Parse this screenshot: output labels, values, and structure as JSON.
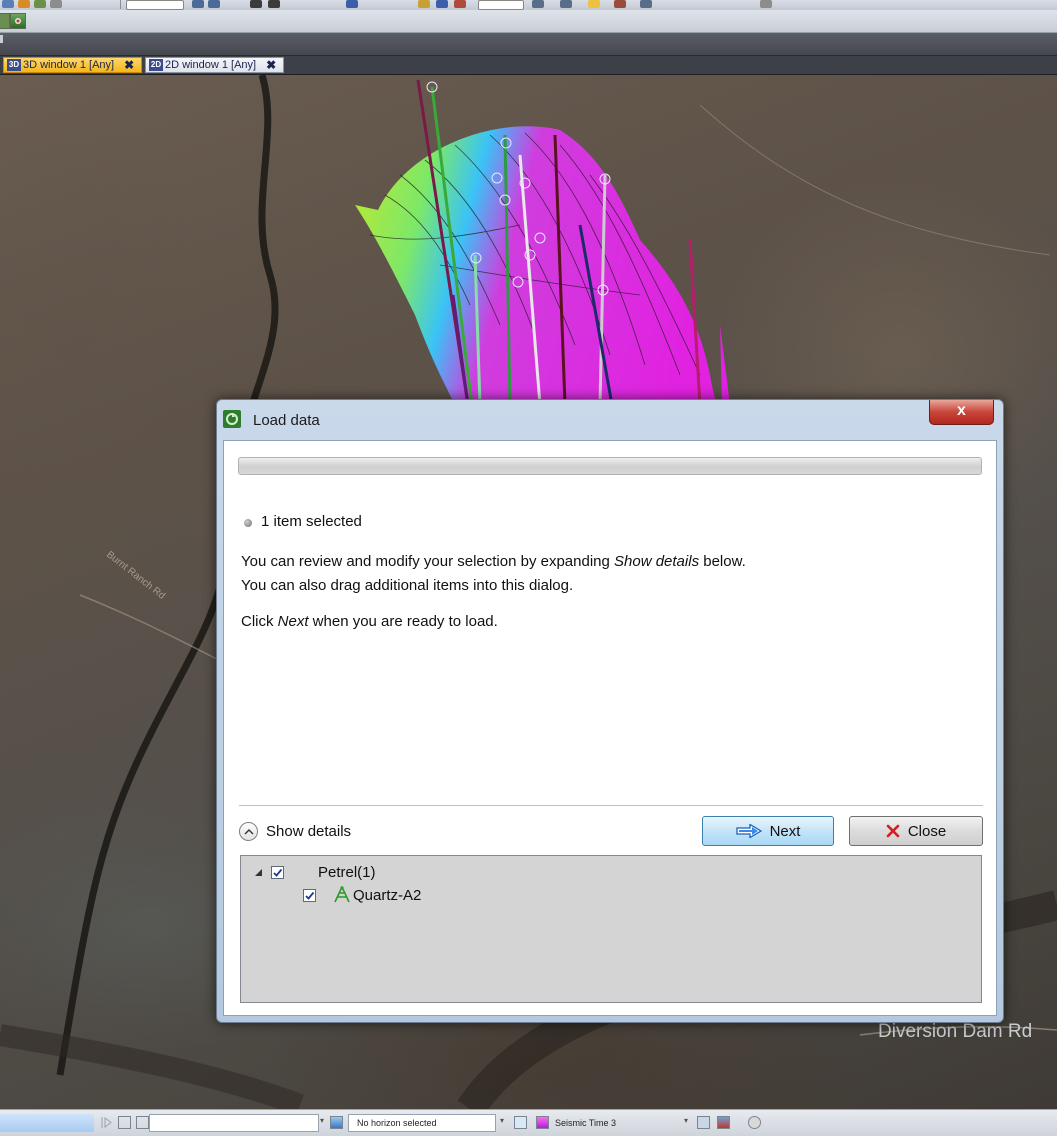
{
  "tabs": [
    {
      "icon": "3D",
      "label": "3D window 1 [Any]",
      "close": "✖"
    },
    {
      "icon": "2D",
      "label": "2D window 1 [Any]",
      "close": "✖"
    }
  ],
  "viewport": {
    "road_labels": [
      "Burnt Ranch Rd",
      "Diversion Dam Rd"
    ]
  },
  "dialog": {
    "title": "Load data",
    "close_glyph": "x",
    "selection_status": "1 item selected",
    "instructions": {
      "line1_pre": "You can review and modify your selection by expanding ",
      "line1_em": "Show details",
      "line1_post": " below.",
      "line2": "You can also drag additional items into this dialog.",
      "line3_pre": "Click ",
      "line3_em": "Next",
      "line3_post": " when you are ready to load."
    },
    "show_details_label": "Show details",
    "next_label": "Next",
    "close_label": "Close",
    "tree": [
      {
        "label": "Petrel(1)",
        "checked": true,
        "expanded": true
      },
      {
        "label": "Quartz-A2",
        "checked": true,
        "icon": "well-icon"
      }
    ]
  },
  "statusbar": {
    "horizon_field": "No horizon selected",
    "seismic_label": "Seismic Time 3"
  },
  "colors": {
    "active_tab": "#f5b51c",
    "dialog_close": "#c8463a",
    "next_button": "#c4e4f8"
  }
}
